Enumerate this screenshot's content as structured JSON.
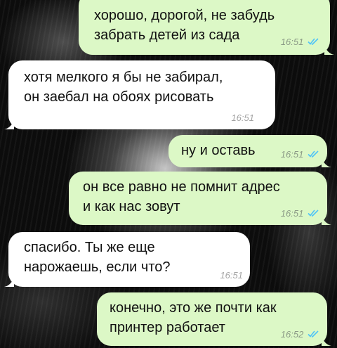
{
  "messages": [
    {
      "direction": "out",
      "text": "хорошо, дорогой, не забудь\nзабрать детей из сада",
      "time": "16:51",
      "read": true
    },
    {
      "direction": "in",
      "text": "хотя мелкого я бы не забирал,\nон заебал на обоях рисовать",
      "time": "16:51"
    },
    {
      "direction": "out",
      "text": "ну и оставь",
      "time": "16:51",
      "read": true
    },
    {
      "direction": "out",
      "text": "он все равно не помнит адрес\nи как нас зовут",
      "time": "16:51",
      "read": true
    },
    {
      "direction": "in",
      "text": "спасибо. Ты же еще\nнарожаешь, если что?",
      "time": "16:51"
    },
    {
      "direction": "out",
      "text": "конечно, это же почти как\nпринтер работает",
      "time": "16:52",
      "read": true
    }
  ],
  "colors": {
    "outgoing_bubble": "#dcf8c6",
    "incoming_bubble": "#ffffff",
    "read_check": "#4fc3f7"
  },
  "icons": {
    "read_receipt": "double-check-icon"
  }
}
